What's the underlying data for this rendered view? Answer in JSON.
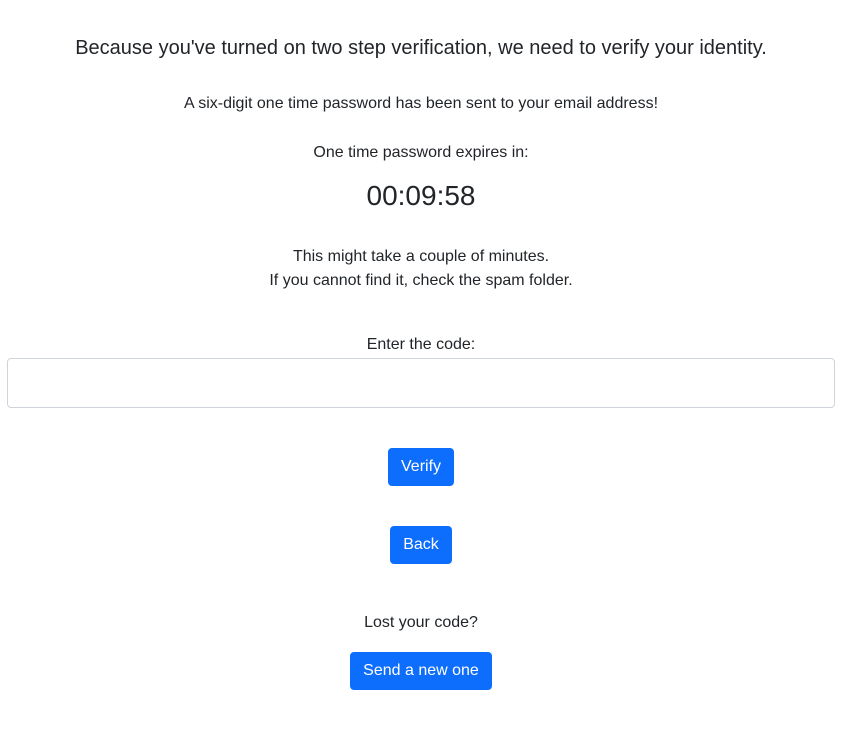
{
  "heading": "Because you've turned on two step verification, we need to verify your identity.",
  "sent_message": "A six-digit one time password has been sent to your email address!",
  "expires_label": "One time password expires in:",
  "timer": "00:09:58",
  "hint_line1": "This might take a couple of minutes.",
  "hint_line2": "If you cannot find it, check the spam folder.",
  "code_label": "Enter the code:",
  "code_input": {
    "value": "",
    "placeholder": ""
  },
  "verify_label": "Verify",
  "back_label": "Back",
  "lost_code_label": "Lost your code?",
  "send_new_label": "Send a new one",
  "colors": {
    "primary": "#0d6efd",
    "text": "#212529",
    "border": "#ced4da"
  }
}
